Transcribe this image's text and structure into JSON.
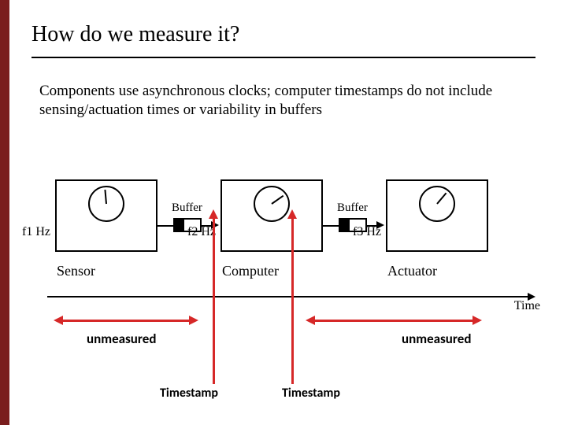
{
  "title": "How do we measure it?",
  "description": "Components use asynchronous clocks; computer timestamps do not include sensing/actuation times or variability in buffers",
  "blocks": {
    "sensor": {
      "label": "Sensor",
      "freq": "f1 Hz"
    },
    "computer": {
      "label": "Computer",
      "freq": "f2 Hz"
    },
    "actuator": {
      "label": "Actuator",
      "freq": "f3 Hz"
    }
  },
  "buffer_label": "Buffer",
  "time_axis": "Time",
  "annotations": {
    "unmeasured": "unmeasured",
    "timestamp": "Timestamp"
  }
}
